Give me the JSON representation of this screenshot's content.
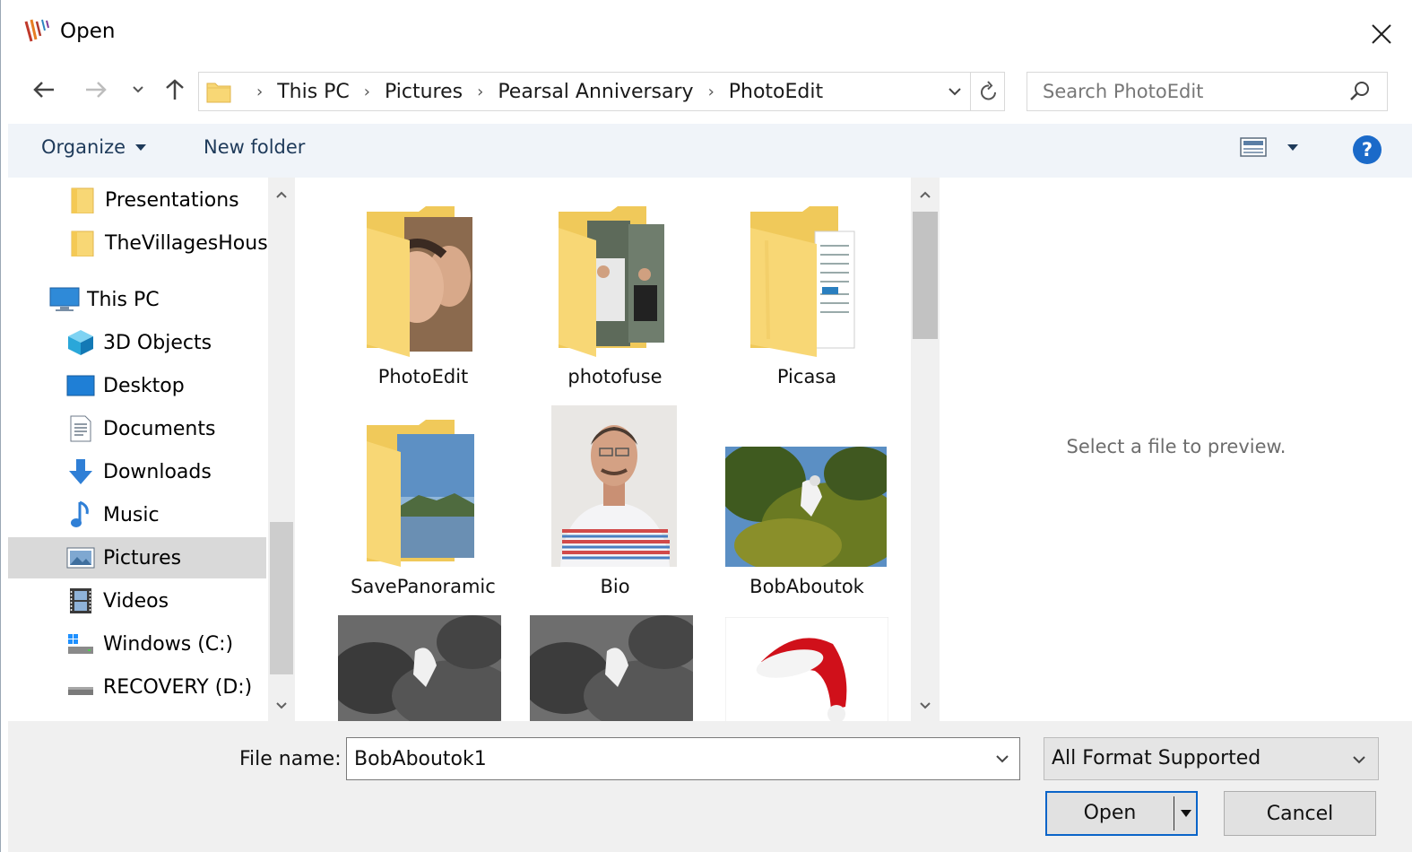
{
  "window": {
    "title": "Open",
    "app_icon": "application-logo"
  },
  "navigation": {
    "back_icon": "back-arrow-icon",
    "forward_icon": "forward-arrow-icon",
    "recent_icon": "recent-locations-chevron-icon",
    "up_icon": "up-arrow-icon",
    "breadcrumbs": [
      "This PC",
      "Pictures",
      "Pearsal Anniversary",
      "PhotoEdit"
    ],
    "refresh_icon": "refresh-icon",
    "search_placeholder": "Search PhotoEdit"
  },
  "toolbar": {
    "organize_label": "Organize",
    "new_folder_label": "New folder",
    "view_icon": "change-view-icon",
    "help_label": "?"
  },
  "nav_pane": {
    "items": [
      {
        "label": "Presentations",
        "icon": "folder-icon"
      },
      {
        "label": "TheVillagesHouse",
        "icon": "folder-icon"
      },
      {
        "label": "This PC",
        "icon": "computer-icon"
      },
      {
        "label": "3D Objects",
        "icon": "cube-icon"
      },
      {
        "label": "Desktop",
        "icon": "desktop-icon"
      },
      {
        "label": "Documents",
        "icon": "documents-icon"
      },
      {
        "label": "Downloads",
        "icon": "download-arrow-icon"
      },
      {
        "label": "Music",
        "icon": "music-note-icon"
      },
      {
        "label": "Pictures",
        "icon": "pictures-icon"
      },
      {
        "label": "Videos",
        "icon": "film-icon"
      },
      {
        "label": "Windows (C:)",
        "icon": "windows-drive-icon"
      },
      {
        "label": "RECOVERY (D:)",
        "icon": "drive-icon"
      }
    ],
    "selected": "Pictures"
  },
  "files": [
    {
      "name": "PhotoEdit",
      "type": "folder"
    },
    {
      "name": "photofuse",
      "type": "folder"
    },
    {
      "name": "Picasa",
      "type": "folder"
    },
    {
      "name": "SavePanoramic",
      "type": "folder"
    },
    {
      "name": "Bio",
      "type": "image"
    },
    {
      "name": "BobAboutok",
      "type": "image"
    },
    {
      "name": "",
      "type": "image"
    },
    {
      "name": "",
      "type": "image"
    },
    {
      "name": "",
      "type": "image"
    }
  ],
  "preview": {
    "message": "Select a file to preview."
  },
  "footer": {
    "file_name_label": "File name:",
    "file_name_value": "BobAboutok1",
    "filter_value": "All Format Supported",
    "open_label": "Open",
    "cancel_label": "Cancel"
  }
}
